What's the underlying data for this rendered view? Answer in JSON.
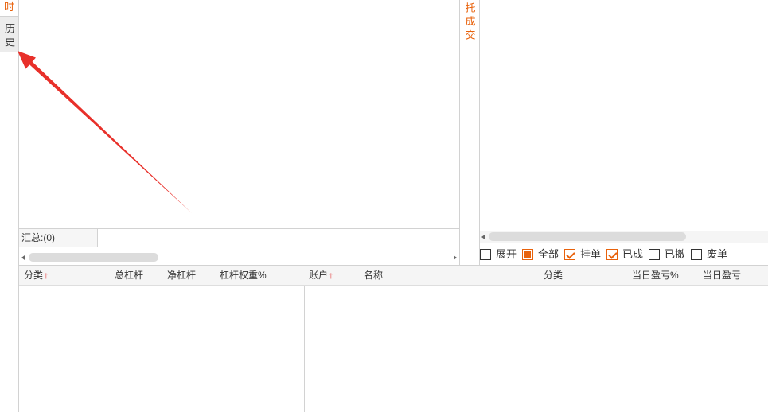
{
  "left_tabs": [
    {
      "label": "时",
      "active": true
    },
    {
      "label": "历史",
      "active": false
    }
  ],
  "middle_tab": {
    "label": "托成交"
  },
  "summary": {
    "label": "汇总:(0)",
    "value": ""
  },
  "filters": [
    {
      "label": "展开",
      "state": "unchecked"
    },
    {
      "label": "全部",
      "state": "indeterminate"
    },
    {
      "label": "挂单",
      "state": "checked"
    },
    {
      "label": "已成",
      "state": "checked"
    },
    {
      "label": "已撤",
      "state": "unchecked"
    },
    {
      "label": "废单",
      "state": "unchecked"
    }
  ],
  "leverage_table": {
    "columns": [
      {
        "label": "分类",
        "sort": "↑"
      },
      {
        "label": "总杠杆"
      },
      {
        "label": "净杠杆"
      },
      {
        "label": "杠杆权重%"
      }
    ],
    "rows": []
  },
  "account_table": {
    "columns": [
      {
        "label": "账户",
        "sort": "↑"
      },
      {
        "label": "名称"
      },
      {
        "label": "分类"
      },
      {
        "label": "当日盈亏%"
      },
      {
        "label": "当日盈亏"
      }
    ],
    "rows": []
  },
  "icons": {
    "scroll_left": "scroll-left-arrow-icon",
    "scroll_right": "scroll-right-arrow-icon",
    "annotation": "red-pointer-arrow"
  },
  "colors": {
    "accent": "#e8620c",
    "sort_arrow": "#e02020",
    "annotation": "#e8302a"
  }
}
